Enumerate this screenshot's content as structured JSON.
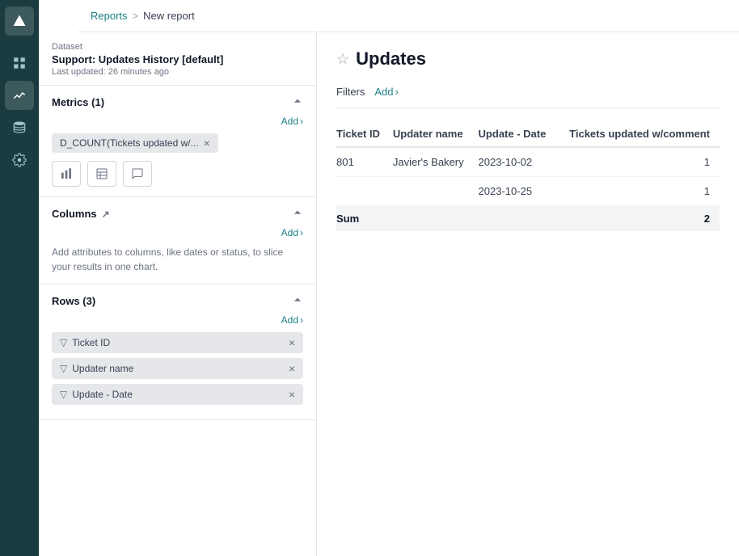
{
  "breadcrumb": {
    "parent": "Reports",
    "separator": ">",
    "current": "New report"
  },
  "dataset": {
    "label": "Dataset",
    "name": "Support: Updates History [default]",
    "updated": "Last updated: 26 minutes ago"
  },
  "metrics": {
    "title": "Metrics (1)",
    "add_label": "Add",
    "tag_text": "D_COUNT(Tickets updated w/...",
    "icon_bar": "bar-chart-icon",
    "icon_table": "table-icon",
    "icon_chat": "chart-icon"
  },
  "columns": {
    "title": "Columns",
    "add_label": "Add",
    "hint": "Add attributes to columns, like dates or status, to slice your results in one chart."
  },
  "rows": {
    "title": "Rows (3)",
    "add_label": "Add",
    "items": [
      {
        "label": "Ticket ID"
      },
      {
        "label": "Updater name"
      },
      {
        "label": "Update - Date"
      }
    ]
  },
  "report": {
    "title": "Updates",
    "filters_label": "Filters",
    "filters_add": "Add",
    "table": {
      "columns": [
        "Ticket ID",
        "Updater name",
        "Update - Date",
        "Tickets updated w/comment"
      ],
      "rows": [
        {
          "ticket_id": "801",
          "updater_name": "Javier's Bakery",
          "update_date": "2023-10-02",
          "count": "1"
        },
        {
          "ticket_id": "",
          "updater_name": "",
          "update_date": "2023-10-25",
          "count": "1"
        }
      ],
      "sum_label": "Sum",
      "sum_value": "2"
    }
  },
  "nav": {
    "items": [
      {
        "name": "logo",
        "label": "Logo"
      },
      {
        "name": "dashboard",
        "label": "Dashboard"
      },
      {
        "name": "chart",
        "label": "Chart"
      },
      {
        "name": "database",
        "label": "Database"
      },
      {
        "name": "settings",
        "label": "Settings"
      }
    ]
  }
}
